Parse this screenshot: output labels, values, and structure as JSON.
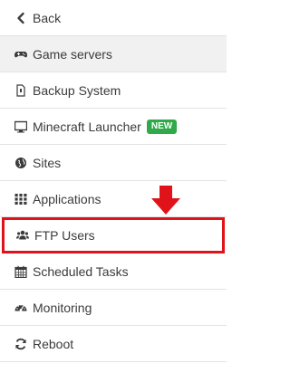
{
  "menu": {
    "items": [
      {
        "label": "Back",
        "icon": "chevron-left-icon"
      },
      {
        "label": "Game servers",
        "icon": "gamepad-icon"
      },
      {
        "label": "Backup System",
        "icon": "file-icon"
      },
      {
        "label": "Minecraft Launcher",
        "icon": "desktop-icon",
        "badge": "NEW"
      },
      {
        "label": "Sites",
        "icon": "globe-icon"
      },
      {
        "label": "Applications",
        "icon": "grid-icon"
      },
      {
        "label": "FTP Users",
        "icon": "users-icon"
      },
      {
        "label": "Scheduled Tasks",
        "icon": "calendar-icon"
      },
      {
        "label": "Monitoring",
        "icon": "dashboard-icon"
      },
      {
        "label": "Reboot",
        "icon": "refresh-icon"
      }
    ],
    "active_item": "Game servers",
    "highlighted_item": "FTP Users"
  },
  "colors": {
    "highlight_border": "#e1131a",
    "badge_background": "#2fa94a",
    "active_background": "#f1f1f1"
  },
  "annotation": {
    "arrow_icon": "down-arrow-icon"
  }
}
